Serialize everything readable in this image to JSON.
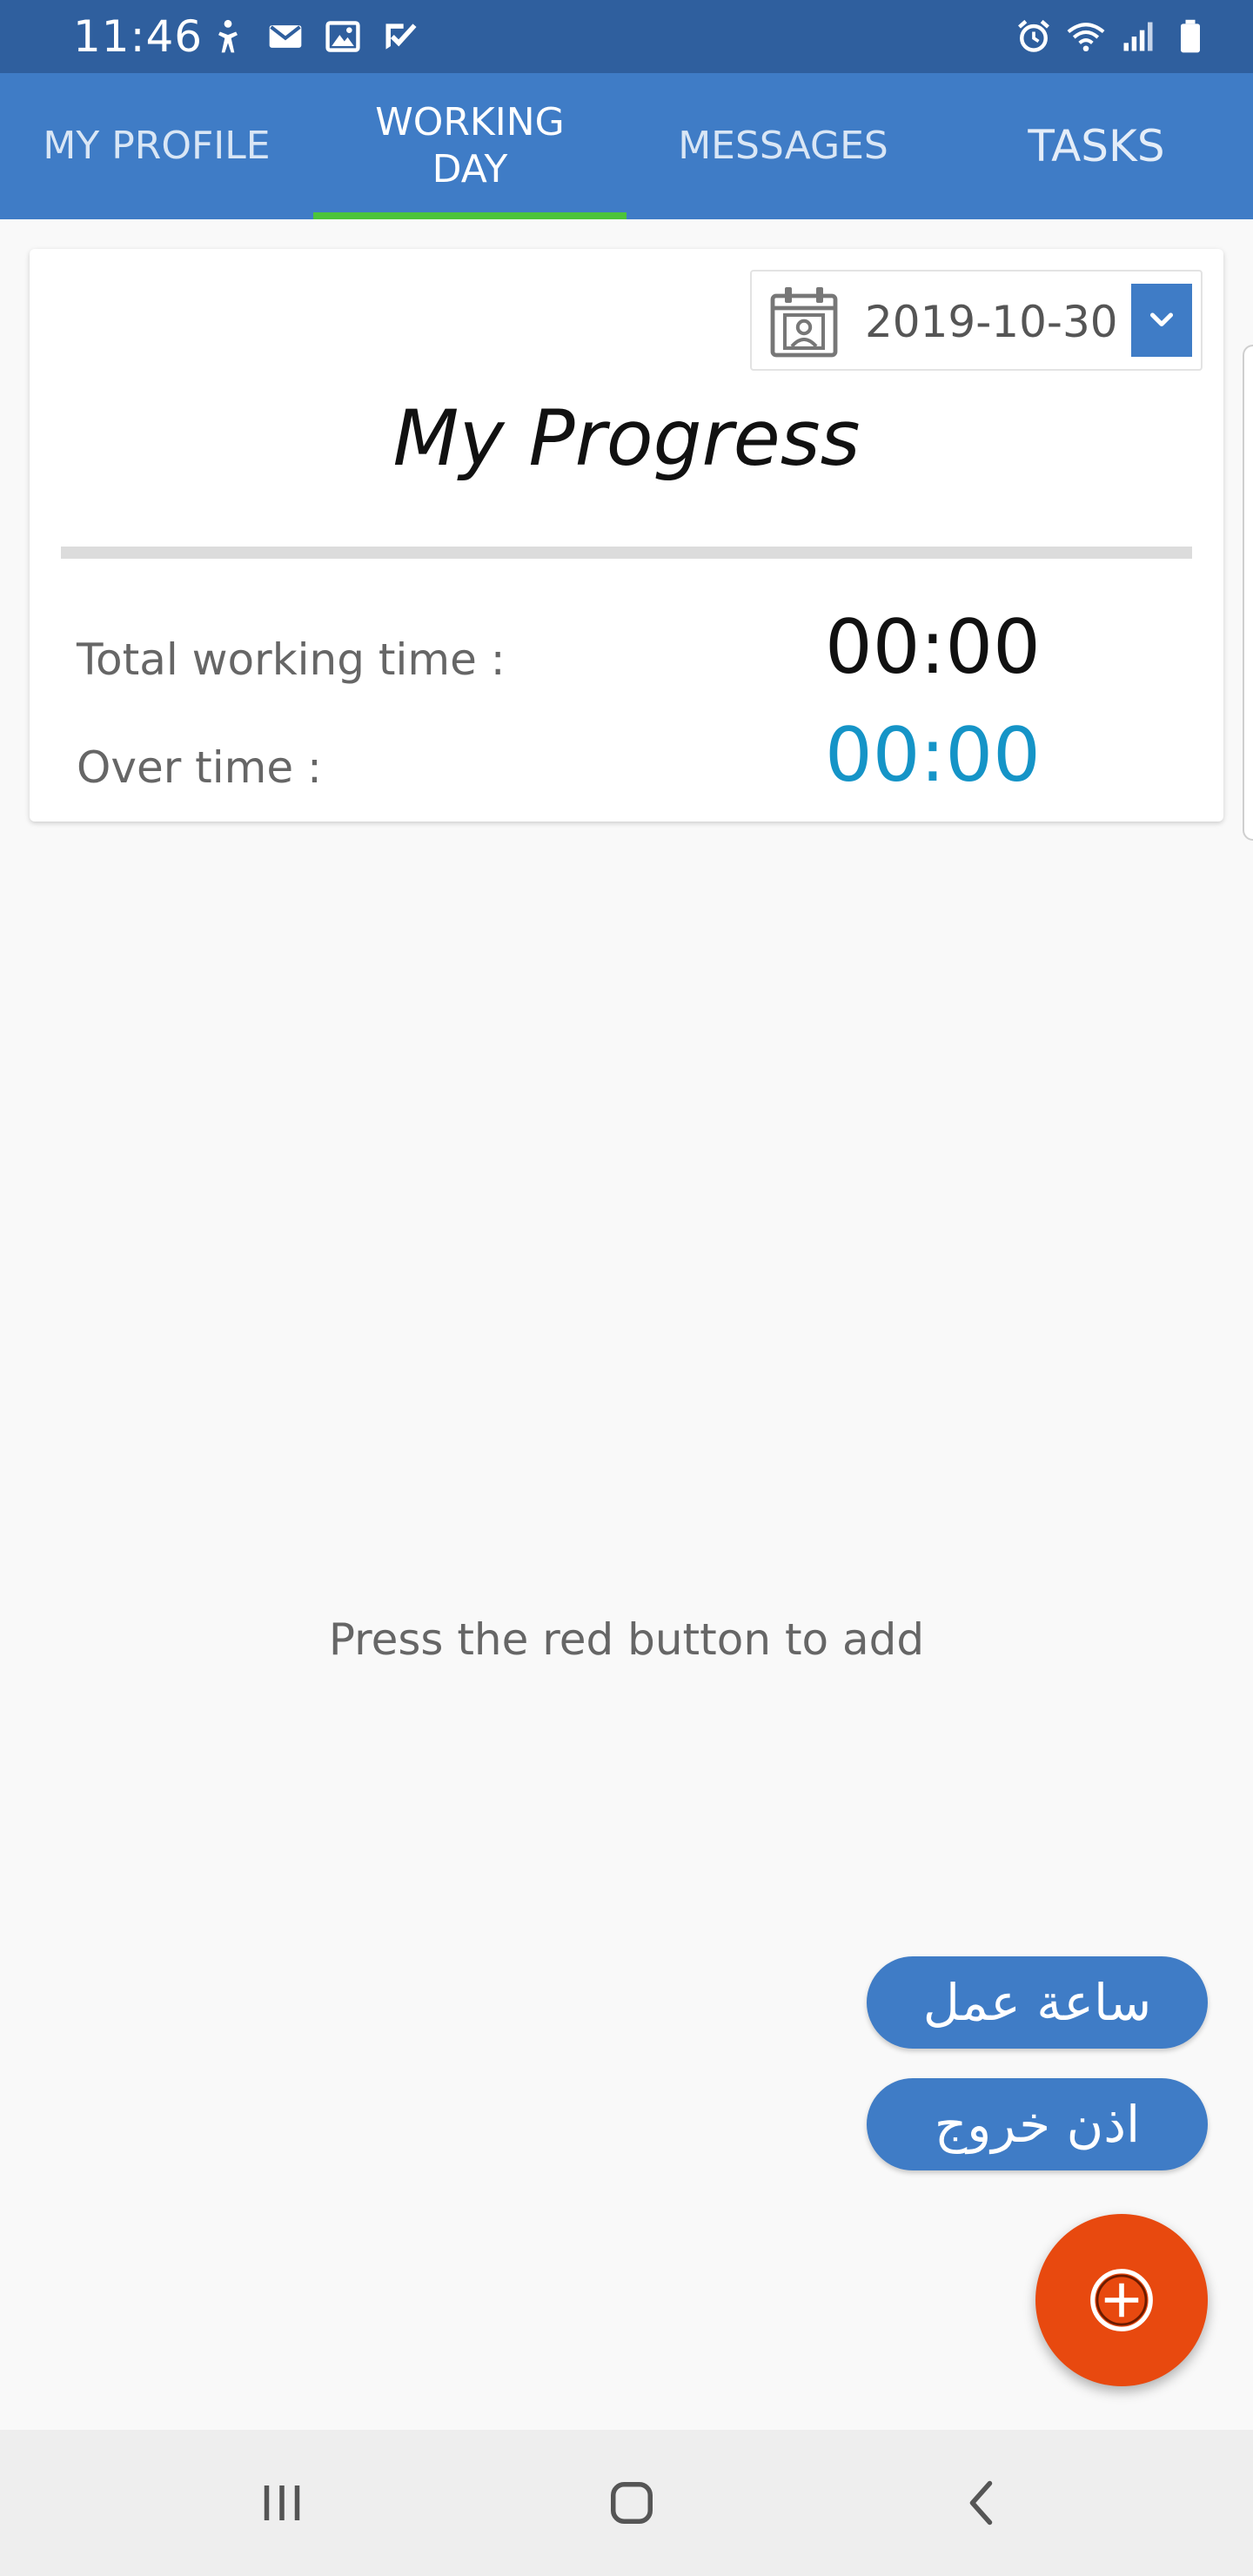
{
  "status_bar": {
    "time": "11:46",
    "left_icons": [
      "accessibility-icon",
      "gmail-icon",
      "gallery-icon",
      "task-check-icon"
    ],
    "right_icons": [
      "alarm-icon",
      "wifi-icon",
      "signal-icon",
      "battery-icon"
    ]
  },
  "tabs": [
    {
      "label": "MY PROFILE",
      "active": false
    },
    {
      "label": "WORKING\nDAY",
      "active": true
    },
    {
      "label": "MESSAGES",
      "active": false
    },
    {
      "label": "TASKS",
      "active": false
    }
  ],
  "progress_card": {
    "date": "2019-10-30",
    "title": "My Progress",
    "total_label": "Total working time :",
    "total_value": "00:00",
    "overtime_label": "Over time :",
    "overtime_value": "00:00"
  },
  "empty_hint": "Press the red button to add",
  "actions": {
    "work_hour": "ساعة عمل",
    "exit_permit": "اذن خروج"
  },
  "colors": {
    "status_bar": "#2f5f9e",
    "app_bar": "#3f7cc6",
    "tab_indicator": "#4cc43a",
    "overtime_value": "#1594c7",
    "fab": "#e8490f"
  }
}
